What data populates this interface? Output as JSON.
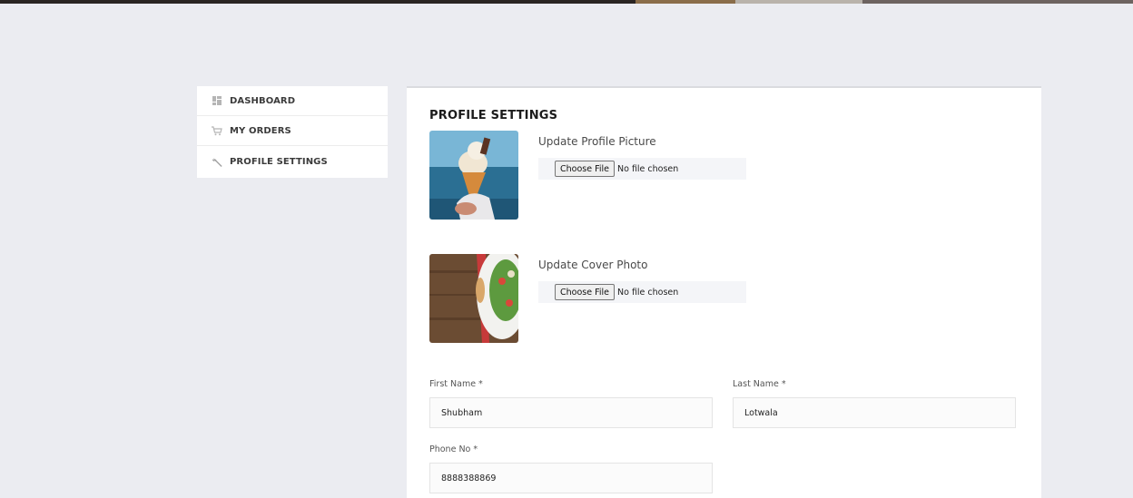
{
  "sidebar": {
    "items": [
      {
        "label": "DASHBOARD",
        "icon": "dashboard-icon"
      },
      {
        "label": "MY ORDERS",
        "icon": "cart-icon"
      },
      {
        "label": "PROFILE SETTINGS",
        "icon": "wrench-icon"
      }
    ]
  },
  "profile": {
    "title": "PROFILE SETTINGS",
    "picture": {
      "label": "Update Profile Picture",
      "button": "Choose File",
      "status": "No file chosen",
      "image": "ice-cream-cone-photo"
    },
    "cover": {
      "label": "Update Cover Photo",
      "button": "Choose File",
      "status": "No file chosen",
      "image": "salad-plate-on-wood-photo"
    },
    "fields": {
      "first_name": {
        "label": "First Name *",
        "value": "Shubham"
      },
      "last_name": {
        "label": "Last Name *",
        "value": "Lotwala"
      },
      "phone": {
        "label": "Phone No *",
        "value": "8888388869"
      }
    }
  },
  "colors": {
    "background": "#ebecf1",
    "panel": "#ffffff",
    "top_strip": "#2a2523"
  }
}
